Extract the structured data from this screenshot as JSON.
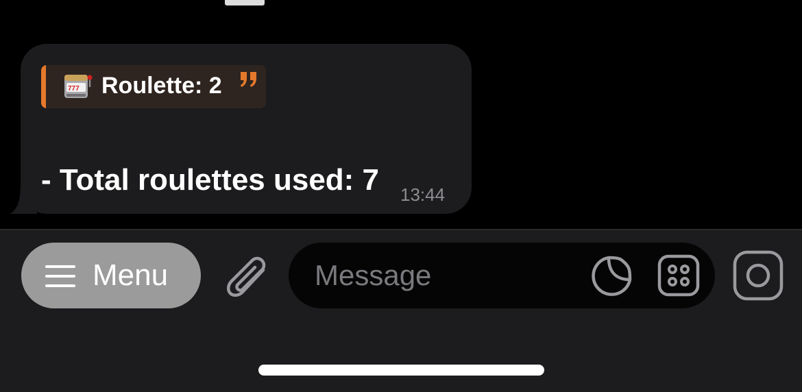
{
  "chat": {
    "message": {
      "quote_text": "Roulette: 2",
      "quote_icon": "slot-machine-icon",
      "body_text": "- Total roulettes used: 7",
      "time": "13:44"
    }
  },
  "composer": {
    "menu_label": "Menu",
    "message_placeholder": "Message",
    "icons": [
      "menu-lines-icon",
      "paperclip-icon",
      "sticker-icon",
      "dice-icon",
      "camera-icon"
    ]
  },
  "colors": {
    "background": "#000000",
    "bubble": "#1c1c1e",
    "quote_accent": "#e5792b",
    "quote_background": "#2f2520",
    "menu_button": "#9b9b9b",
    "icon_gray": "#9a9a9e",
    "timestamp": "#8d8d92"
  }
}
